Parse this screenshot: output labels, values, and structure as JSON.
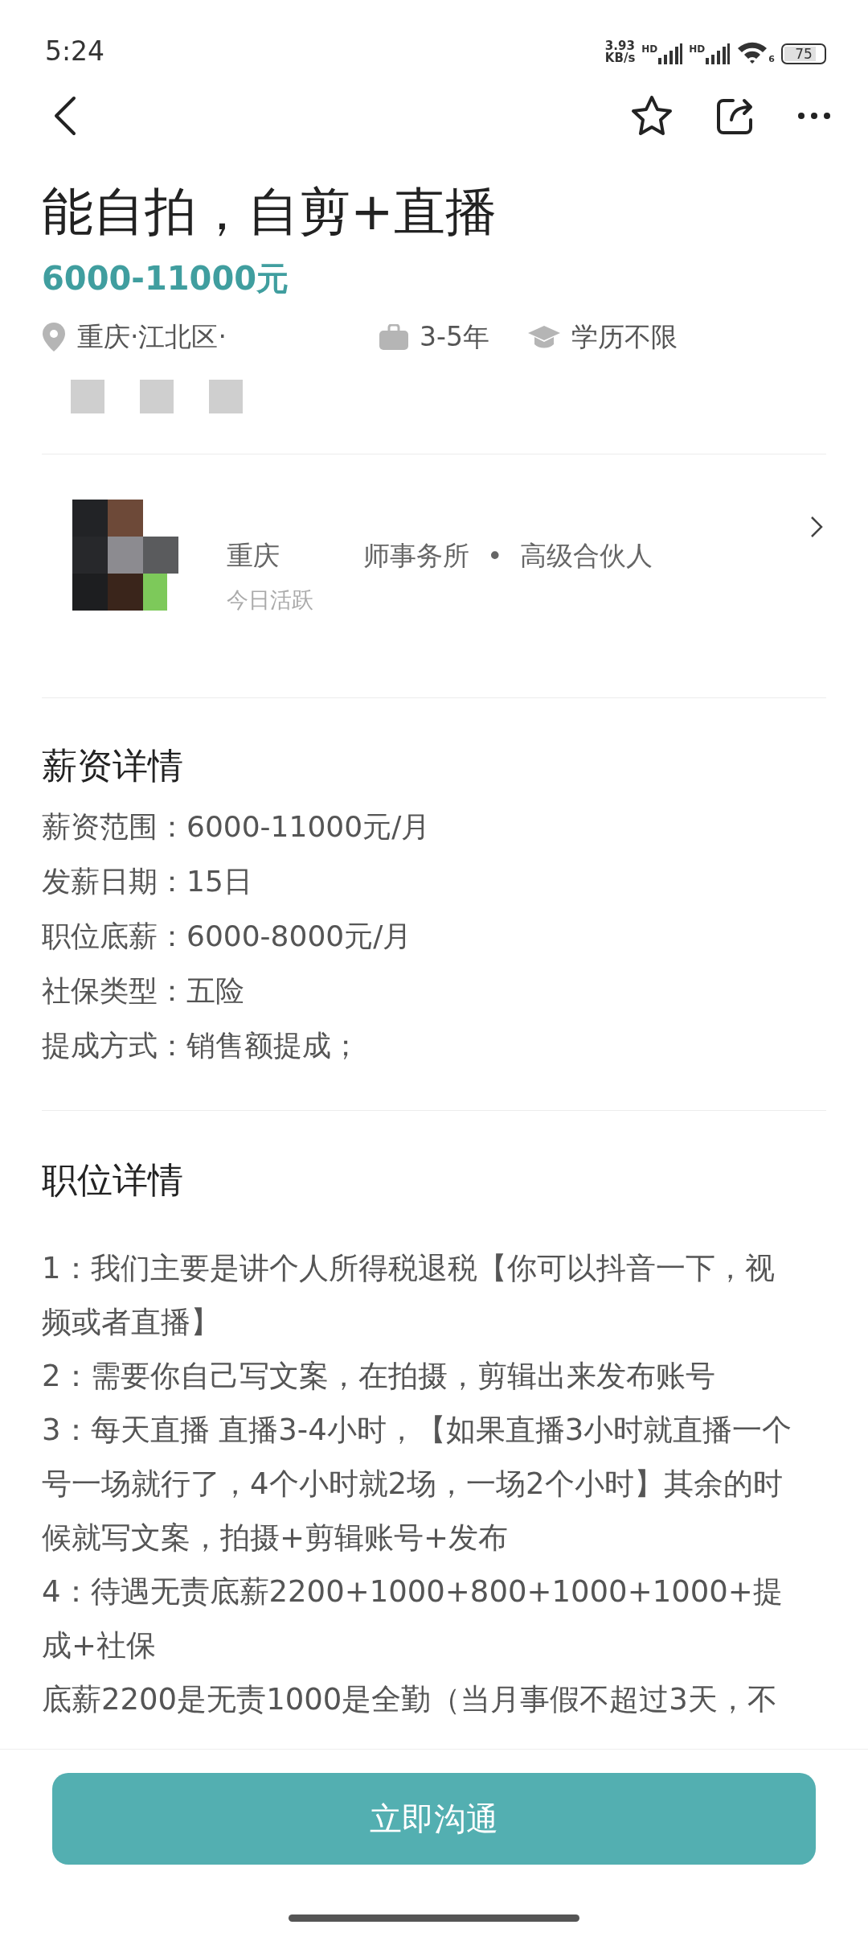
{
  "status_bar": {
    "time": "5:24",
    "speed_value": "3.93",
    "speed_unit": "KB/s",
    "sims": [
      {
        "label": "HD"
      },
      {
        "label": "HD"
      }
    ],
    "wifi_badge": "6",
    "battery": "75"
  },
  "job": {
    "title": "能自拍，自剪+直播",
    "salary": "6000-11000元",
    "meta": [
      {
        "kind": "location",
        "text": "重庆·江北区·"
      },
      {
        "kind": "experience",
        "text": "3-5年"
      },
      {
        "kind": "education",
        "text": "学历不限"
      }
    ]
  },
  "recruiter": {
    "company_start": "重庆",
    "company_end": "师事务所",
    "separator": "•",
    "position": "高级合伙人",
    "activity": "今日活跃"
  },
  "salary_details": {
    "heading": "薪资详情",
    "rows": [
      {
        "label": "薪资范围：",
        "value": "6000-11000元/月"
      },
      {
        "label": "发薪日期：",
        "value": "15日"
      },
      {
        "label": "职位底薪：",
        "value": "6000-8000元/月"
      },
      {
        "label": "社保类型：",
        "value": "五险"
      },
      {
        "label": "提成方式：",
        "value": "销售额提成；"
      }
    ]
  },
  "job_details": {
    "heading": "职位详情",
    "paragraphs": [
      "1：我们主要是讲个人所得税退税【你可以抖音一下，视频或者直播】",
      "2：需要你自己写文案，在拍摄，剪辑出来发布账号",
      "3：每天直播 直播3-4小时，【如果直播3小时就直播一个号一场就行了，4个小时就2场，一场2个小时】其余的时候就写文案，拍摄+剪辑账号+发布",
      "4：待遇无责底薪2200+1000+800+1000+1000+提成+社保",
      "底薪2200是无责1000是全勤（当月事假不超过3天，不"
    ]
  },
  "action_button": "立即沟通"
}
